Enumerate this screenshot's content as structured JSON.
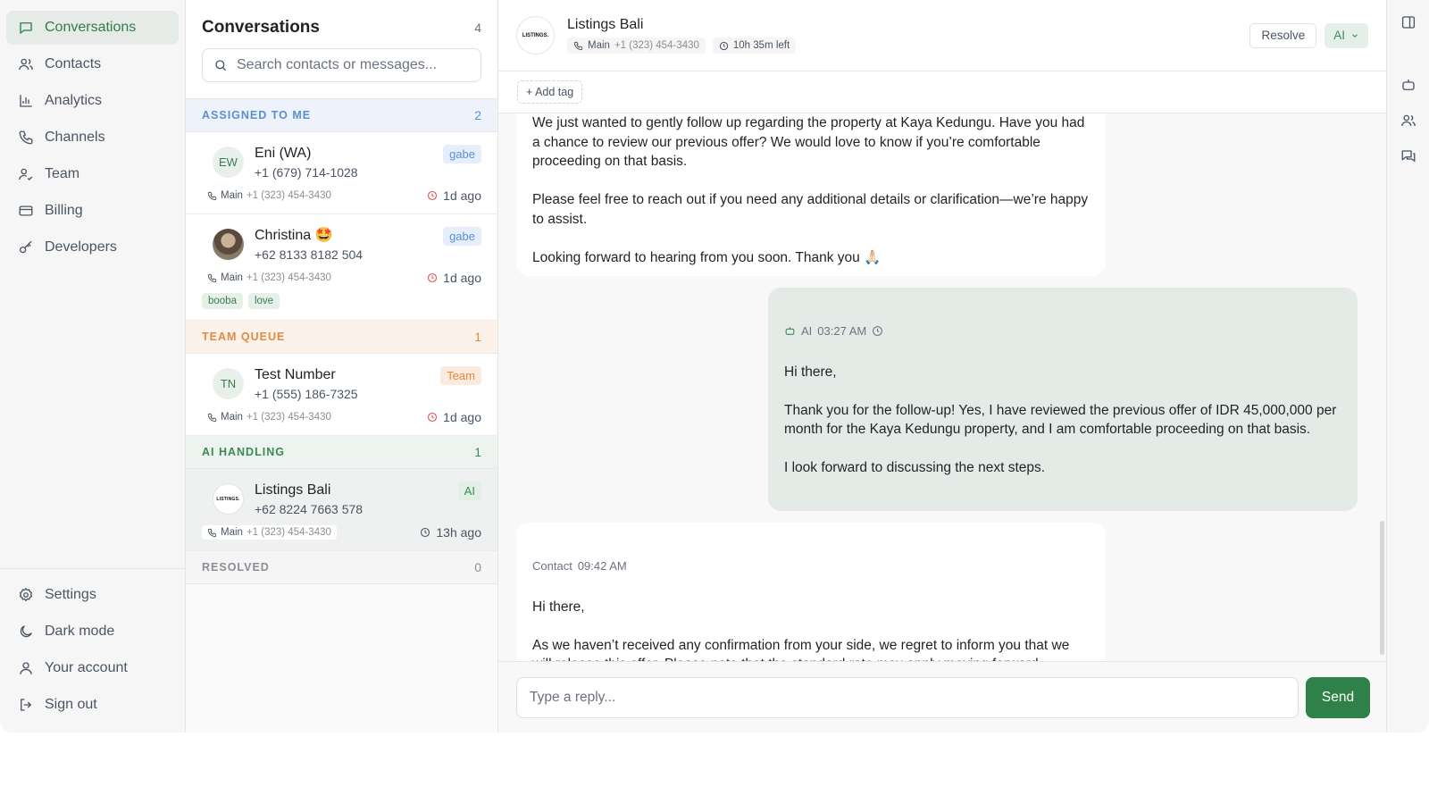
{
  "nav": {
    "top": [
      {
        "label": "Conversations",
        "icon": "chat-icon",
        "active": true
      },
      {
        "label": "Contacts",
        "icon": "users-icon"
      },
      {
        "label": "Analytics",
        "icon": "bar-chart-icon"
      },
      {
        "label": "Channels",
        "icon": "phone-icon"
      },
      {
        "label": "Team",
        "icon": "team-icon"
      },
      {
        "label": "Billing",
        "icon": "card-icon"
      },
      {
        "label": "Developers",
        "icon": "key-icon"
      }
    ],
    "bottom": [
      {
        "label": "Settings",
        "icon": "gear-icon"
      },
      {
        "label": "Dark mode",
        "icon": "moon-icon"
      },
      {
        "label": "Your account",
        "icon": "user-icon"
      },
      {
        "label": "Sign out",
        "icon": "sign-out-icon"
      }
    ]
  },
  "conversations": {
    "title": "Conversations",
    "count": "4",
    "search_placeholder": "Search contacts or messages...",
    "sections": {
      "assigned": {
        "label": "ASSIGNED TO ME",
        "count": "2"
      },
      "team": {
        "label": "TEAM QUEUE",
        "count": "1"
      },
      "ai": {
        "label": "AI HANDLING",
        "count": "1"
      },
      "resolved": {
        "label": "RESOLVED",
        "count": "0"
      }
    },
    "items": [
      {
        "initials": "EW",
        "name": "Eni (WA)",
        "phone": "+1 (679) 714-1028",
        "badge": "gabe",
        "line": "Main",
        "line_number": "+1 (323) 454-3430",
        "time": "1d ago"
      },
      {
        "name": "Christina 🤩",
        "phone": "+62 8133 8182 504",
        "badge": "gabe",
        "line": "Main",
        "line_number": "+1 (323) 454-3430",
        "time": "1d ago",
        "tags": [
          "booba",
          "love"
        ]
      },
      {
        "initials": "TN",
        "name": "Test Number",
        "phone": "+1 (555) 186-7325",
        "badge": "Team",
        "line": "Main",
        "line_number": "+1 (323) 454-3430",
        "time": "1d ago"
      },
      {
        "logo": "LISTINGS.",
        "name": "Listings Bali",
        "phone": "+62 8224 7663 578",
        "badge": "AI",
        "line": "Main",
        "line_number": "+1 (323) 454-3430",
        "time": "13h ago"
      }
    ]
  },
  "chat": {
    "logo": "LISTINGS.",
    "title": "Listings Bali",
    "line": "Main",
    "line_number": "+1 (323) 454-3430",
    "time_left": "10h 35m left",
    "resolve_label": "Resolve",
    "mode_label": "AI",
    "add_tag_label": "+ Add tag",
    "messages": [
      {
        "text": "We just wanted to gently follow up regarding the property at Kaya Kedungu. Have you had a chance to review our previous offer? We would love to know if you’re comfortable proceeding on that basis.\n\nPlease feel free to reach out if you need any additional details or clarification—we’re happy to assist.\n\nLooking forward to hearing from you soon. Thank you 🙏🏻"
      },
      {
        "sender": "AI",
        "time": "03:27 AM",
        "text": "Hi there,\n\nThank you for the follow-up! Yes, I have reviewed the previous offer of IDR 45,000,000 per month for the Kaya Kedungu property, and I am comfortable proceeding on that basis.\n\nI look forward to discussing the next steps."
      },
      {
        "sender": "Contact",
        "time": "09:42 AM",
        "text": "Hi there,\n\nAs we haven’t received any confirmation from your side, we regret to inform you that we will release this offer. Please note that the standard rate may apply moving forward.\n\nThank you for your understanding."
      }
    ],
    "reply_placeholder": "Type a reply...",
    "send_label": "Send"
  }
}
